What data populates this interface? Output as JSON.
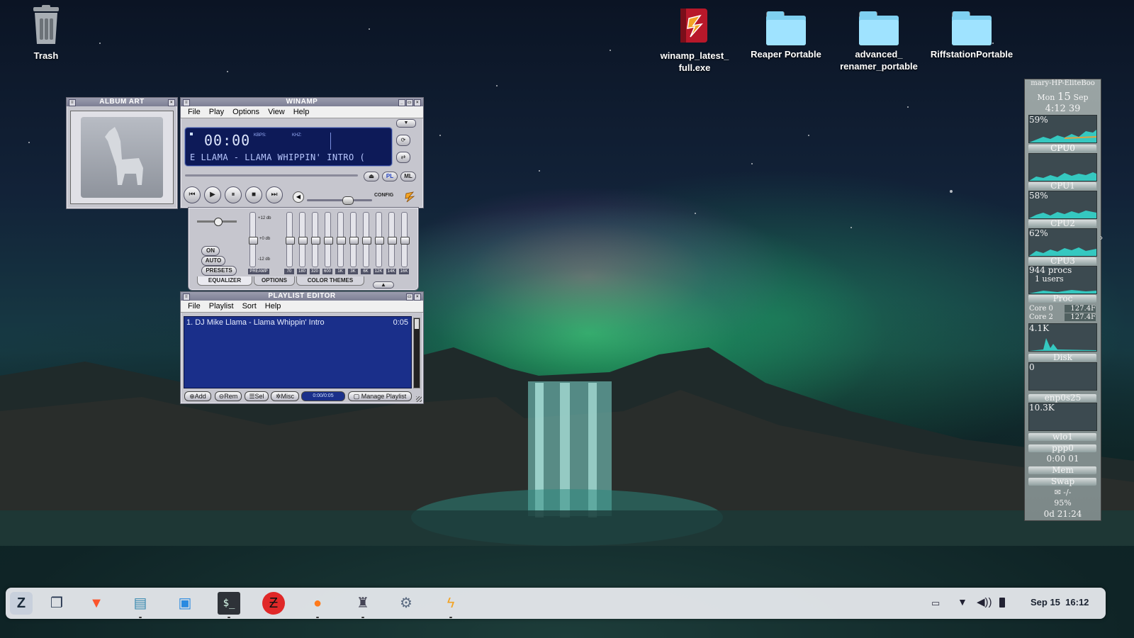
{
  "desktop": {
    "trash_label": "Trash",
    "icons": [
      {
        "label": "winamp_latest_\nfull.exe",
        "line1": "winamp_latest_",
        "line2": "full.exe"
      },
      {
        "label": "Reaper Portable",
        "line1": "Reaper Portable",
        "line2": ""
      },
      {
        "label": "advanced_\nrenamer_portable",
        "line1": "advanced_",
        "line2": "renamer_portable"
      },
      {
        "label": "RiffstationPortable",
        "line1": "RiffstationPortable",
        "line2": ""
      }
    ]
  },
  "album_art": {
    "title": "ALBUM ART"
  },
  "winamp": {
    "title": "WINAMP",
    "menu": [
      "File",
      "Play",
      "Options",
      "View",
      "Help"
    ],
    "time": "00:00",
    "kbps_label": "KBPS:",
    "khz_label": "KHZ:",
    "marquee": "E LLAMA - LLAMA WHIPPIN' INTRO (",
    "pl_button": "PL",
    "ml_button": "ML",
    "config_label": "CONFIG",
    "eq": {
      "preamp_label": "PREAMP",
      "db_top": "+12 db",
      "db_mid": "+0 db",
      "db_bottom": "-12 db",
      "on_label": "ON",
      "auto_label": "AUTO",
      "presets_label": "PRESETS",
      "bands": [
        "70",
        "180",
        "320",
        "600",
        "1K",
        "3K",
        "6K",
        "12K",
        "14K",
        "16K"
      ],
      "tabs": [
        "EQUALIZER",
        "OPTIONS",
        "COLOR THEMES"
      ]
    }
  },
  "playlist": {
    "title": "PLAYLIST EDITOR",
    "menu": [
      "File",
      "Playlist",
      "Sort",
      "Help"
    ],
    "items": [
      {
        "title": "1. DJ Mike Llama - Llama Whippin' Intro",
        "duration": "0:05"
      }
    ],
    "buttons": {
      "add": "Add",
      "rem": "Rem",
      "sel": "Sel",
      "misc": "Misc",
      "time": "0:00/0:05",
      "manage": "Manage Playlist"
    }
  },
  "conky": {
    "host": "mary-HP-EliteBoo",
    "day": "Mon",
    "date": "15",
    "month": "Sep",
    "time": "4:12 39",
    "cpu_total": "59%",
    "cpu0_label": "CPU0",
    "cpu1_label": "CPU1",
    "cpu1_value": "58%",
    "cpu2_label": "CPU2",
    "cpu2_value": "62%",
    "cpu3_label": "CPU3",
    "procs": "944 procs",
    "users": "1 users",
    "proc_label": "Proc",
    "core0_label": "Core 0",
    "core0_value": "127.4F",
    "core2_label": "Core 2",
    "core2_value": "127.4F",
    "proc_value": "4.1K",
    "disk_label": "Disk",
    "disk_value": "0",
    "net1_label": "enp0s25",
    "net1_value": "10.3K",
    "net2_label": "wlo1",
    "net3_label": "ppp0",
    "net3_value": "0:00 01",
    "mem_label": "Mem",
    "swap_label": "Swap",
    "mail_value": "-/-",
    "battery": "95%",
    "uptime": "0d 21:24"
  },
  "taskbar": {
    "date": "Sep 15",
    "time": "16:12"
  },
  "colors": {
    "lcd_bg": "#0d1a58",
    "lcd_text": "#cfe0ff",
    "playlist_bg": "#1a2f8a",
    "taskbar_bg": "#eceef2"
  }
}
